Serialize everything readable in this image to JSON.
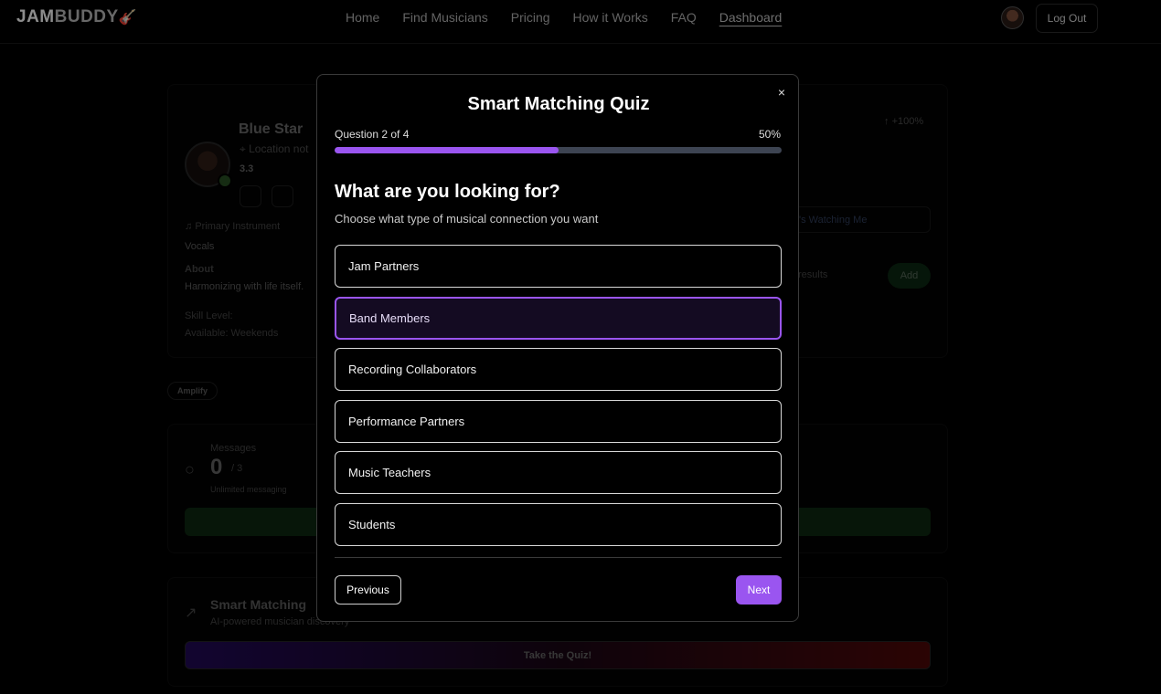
{
  "nav": {
    "logo_jam": "JAM",
    "logo_buddy": "BUDDY",
    "logo_guitar": "🎸",
    "links": [
      {
        "label": "Home"
      },
      {
        "label": "Find Musicians"
      },
      {
        "label": "Pricing"
      },
      {
        "label": "How it Works"
      },
      {
        "label": "FAQ"
      },
      {
        "label": "Dashboard"
      }
    ],
    "logout_label": "Log Out"
  },
  "profile": {
    "name": "Blue Star",
    "location": "Location not",
    "rating": "3.3",
    "primary_instrument_label": "Primary Instrument",
    "primary_instrument": "Vocals",
    "about_label": "About",
    "about": "Harmonizing with life itself.",
    "skill_level": "Skill Level:",
    "available": "Available: Weekends",
    "percent_change": "+100%",
    "watching_label": "'s Watching Me",
    "results_label": "results",
    "add_label": "Add"
  },
  "amplify_label": "Amplify",
  "messages": {
    "label": "Messages",
    "count": "0",
    "limit": "/ 3",
    "note": "Unlimited messaging"
  },
  "smart_matching": {
    "title": "Smart Matching",
    "subtitle": "AI-powered musician discovery",
    "quiz_button": "Take the Quiz!"
  },
  "modal": {
    "title": "Smart Matching Quiz",
    "close": "×",
    "counter": "Question 2 of 4",
    "percent": "50%",
    "progress": 0.5,
    "heading": "What are you looking for?",
    "subheading": "Choose what type of musical connection you want",
    "options": [
      {
        "label": "Jam Partners",
        "selected": false
      },
      {
        "label": "Band Members",
        "selected": true
      },
      {
        "label": "Recording Collaborators",
        "selected": false
      },
      {
        "label": "Performance Partners",
        "selected": false
      },
      {
        "label": "Music Teachers",
        "selected": false
      },
      {
        "label": "Students",
        "selected": false
      }
    ],
    "previous_label": "Previous",
    "next_label": "Next"
  },
  "colors": {
    "accent": "#9a55f0",
    "progress_track": "#3d4452",
    "green": "#1f5a26"
  }
}
